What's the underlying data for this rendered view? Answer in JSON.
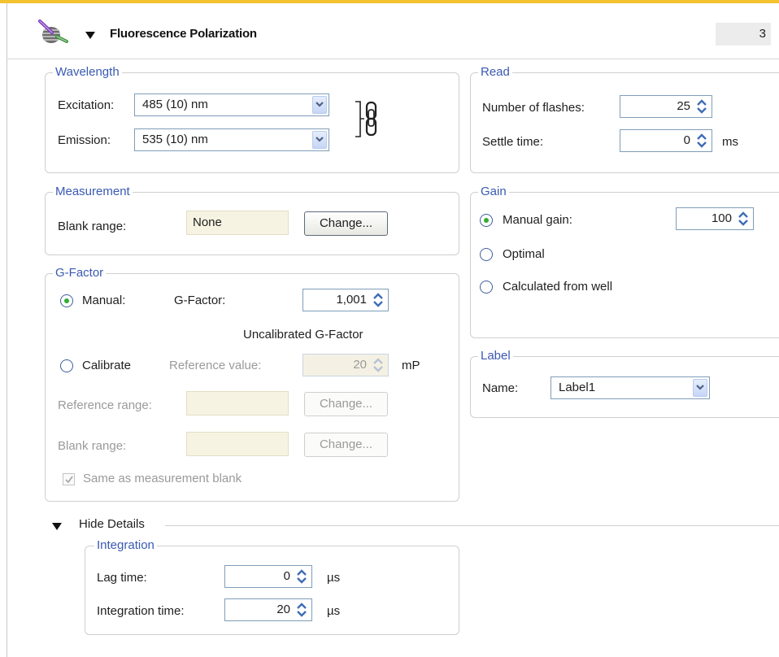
{
  "header": {
    "title": "Fluorescence Polarization",
    "step_number": "3"
  },
  "wavelength": {
    "legend": "Wavelength",
    "excitation_label": "Excitation:",
    "excitation_value": "485 (10) nm",
    "emission_label": "Emission:",
    "emission_value": "535 (10) nm"
  },
  "read": {
    "legend": "Read",
    "flashes_label": "Number of flashes:",
    "flashes_value": "25",
    "settle_label": "Settle time:",
    "settle_value": "0",
    "settle_unit": "ms"
  },
  "measurement": {
    "legend": "Measurement",
    "blank_label": "Blank range:",
    "blank_value": "None",
    "change_label": "Change..."
  },
  "gain": {
    "legend": "Gain",
    "manual_label": "Manual gain:",
    "manual_value": "100",
    "optimal_label": "Optimal",
    "calculated_label": "Calculated from well",
    "selected": "manual"
  },
  "gfactor": {
    "legend": "G-Factor",
    "manual_label": "Manual:",
    "gfactor_label": "G-Factor:",
    "gfactor_value": "1,001",
    "uncalibrated_text": "Uncalibrated G-Factor",
    "calibrate_label": "Calibrate",
    "reference_value_label": "Reference value:",
    "reference_value": "20",
    "reference_unit": "mP",
    "reference_range_label": "Reference range:",
    "blank_range_label": "Blank range:",
    "change_label": "Change...",
    "same_as_label": "Same as measurement blank",
    "same_as_checked": true,
    "selected": "manual"
  },
  "label_group": {
    "legend": "Label",
    "name_label": "Name:",
    "name_value": "Label1"
  },
  "details": {
    "toggle_label": "Hide Details",
    "integration": {
      "legend": "Integration",
      "lag_label": "Lag time:",
      "lag_value": "0",
      "lag_unit": "µs",
      "int_label": "Integration time:",
      "int_value": "20",
      "int_unit": "µs"
    }
  },
  "colors": {
    "legend": "#3a59b2",
    "header_accent": "#f2c230",
    "readonly_bg": "#f7f3e2",
    "radio_dot": "#2fae2f"
  }
}
